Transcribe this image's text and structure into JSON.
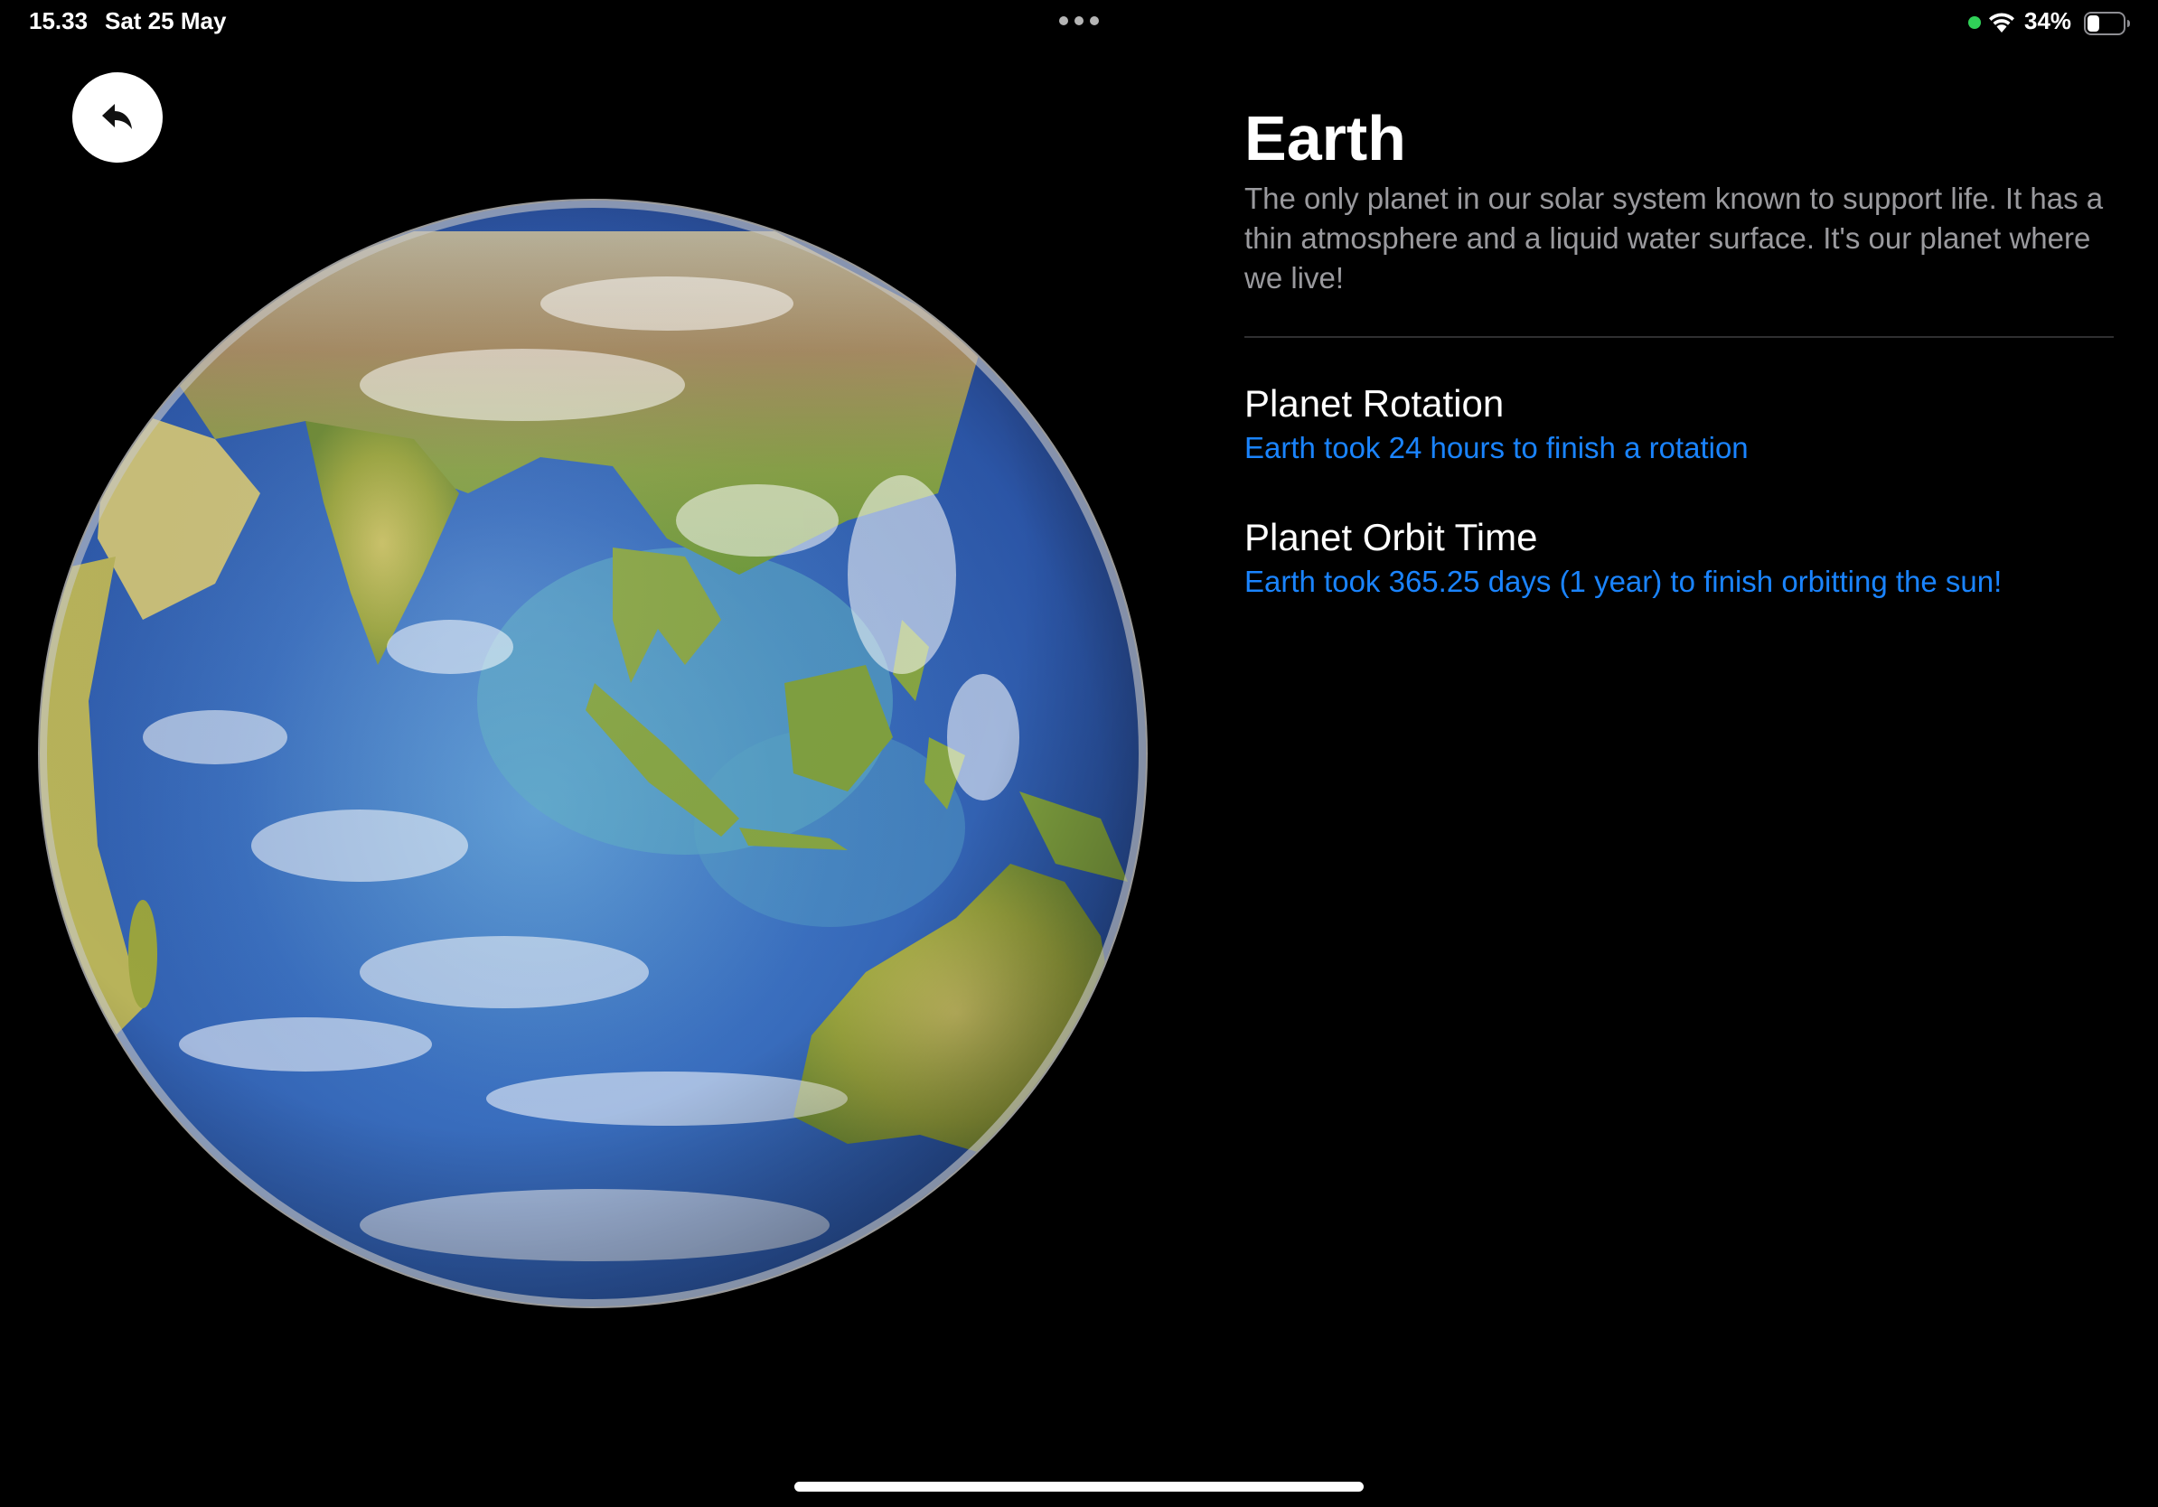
{
  "status_bar": {
    "time": "15.33",
    "date": "Sat 25 May",
    "battery_percent": "34%",
    "battery_level": 0.34,
    "indicator_color": "#30d158",
    "wifi": "wifi-icon",
    "multitask": "multitask-dots-icon"
  },
  "back_button": {
    "icon": "back-arrow-icon"
  },
  "planet": {
    "name": "Earth",
    "description": "The only planet in our solar system known to support life. It has a thin atmosphere and a liquid water surface. It's our planet where we live!",
    "image": "earth-globe"
  },
  "facts": [
    {
      "title": "Planet Rotation",
      "value": "Earth took 24 hours to finish a rotation"
    },
    {
      "title": "Planet Orbit Time",
      "value": "Earth took 365.25 days (1 year) to finish orbitting the sun!"
    }
  ],
  "colors": {
    "background": "#000000",
    "accent": "#1a84ff",
    "description_text": "#9a9a9e",
    "divider": "#2f2f31"
  }
}
